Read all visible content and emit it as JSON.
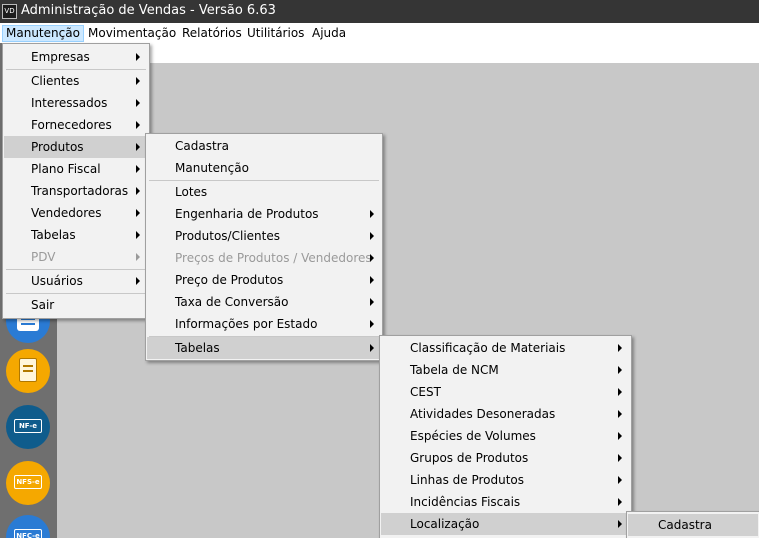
{
  "window": {
    "title": "Administração de Vendas - Versão 6.63",
    "icon_text": "VD"
  },
  "menubar": [
    {
      "label": "Manutenção"
    },
    {
      "label": "Movimentação"
    },
    {
      "label": "Relatórios"
    },
    {
      "label": "Utilitários"
    },
    {
      "label": "Ajuda"
    }
  ],
  "sidebar_icons": [
    {
      "name": "menu-icon",
      "color": "#2a7bd4"
    },
    {
      "name": "notes-icon",
      "color": "#f5a800"
    },
    {
      "name": "nfe-icon",
      "color": "#0f5c8c",
      "label": "NF-e"
    },
    {
      "name": "nfse-icon",
      "color": "#f5a800",
      "label": "NFS-e"
    },
    {
      "name": "nfce-icon",
      "color": "#2a7bd4",
      "label": "NFC-e"
    }
  ],
  "menu_manutencao": {
    "items": [
      {
        "label": "Empresas",
        "submenu": true
      },
      {
        "label": "Clientes",
        "submenu": true
      },
      {
        "label": "Interessados",
        "submenu": true
      },
      {
        "label": "Fornecedores",
        "submenu": true
      },
      {
        "label": "Produtos",
        "submenu": true,
        "highlighted": true
      },
      {
        "label": "Plano Fiscal",
        "submenu": true
      },
      {
        "label": "Transportadoras",
        "submenu": true
      },
      {
        "label": "Vendedores",
        "submenu": true
      },
      {
        "label": "Tabelas",
        "submenu": true
      },
      {
        "label": "PDV",
        "submenu": true,
        "disabled": true
      },
      {
        "label": "Usuários",
        "submenu": true
      },
      {
        "label": "Sair",
        "submenu": false
      }
    ]
  },
  "menu_produtos": {
    "items": [
      {
        "label": "Cadastra"
      },
      {
        "label": "Manutenção"
      },
      {
        "label": "Lotes"
      },
      {
        "label": "Engenharia de Produtos",
        "submenu": true
      },
      {
        "label": "Produtos/Clientes",
        "submenu": true
      },
      {
        "label": "Preços de Produtos / Vendedores",
        "submenu": true,
        "disabled": true
      },
      {
        "label": "Preço de Produtos",
        "submenu": true
      },
      {
        "label": "Taxa de Conversão",
        "submenu": true
      },
      {
        "label": "Informações por Estado",
        "submenu": true
      },
      {
        "label": "Tabelas",
        "submenu": true,
        "highlighted": true
      }
    ]
  },
  "menu_tabelas": {
    "items": [
      {
        "label": "Classificação de Materiais",
        "submenu": true
      },
      {
        "label": "Tabela de NCM",
        "submenu": true
      },
      {
        "label": "CEST",
        "submenu": true
      },
      {
        "label": "Atividades Desoneradas",
        "submenu": true
      },
      {
        "label": "Espécies de Volumes",
        "submenu": true
      },
      {
        "label": "Grupos de Produtos",
        "submenu": true
      },
      {
        "label": "Linhas de Produtos",
        "submenu": true
      },
      {
        "label": "Incidências Fiscais",
        "submenu": true
      },
      {
        "label": "Localização",
        "submenu": true,
        "highlighted": true
      }
    ]
  },
  "menu_localizacao": {
    "items": [
      {
        "label": "Cadastra",
        "highlighted": true
      }
    ]
  }
}
